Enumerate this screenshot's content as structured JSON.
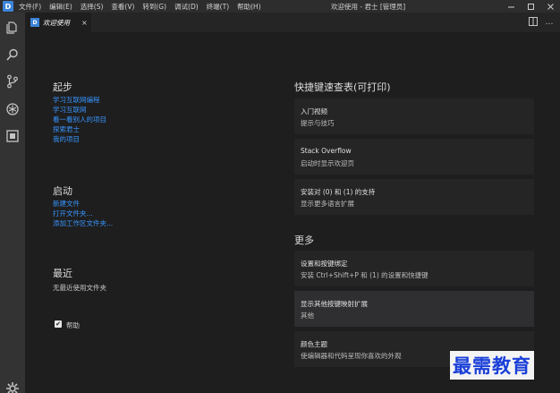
{
  "titlebar": {
    "logo": "D",
    "menu": [
      "文件(F)",
      "编辑(E)",
      "选择(S)",
      "查看(V)",
      "转到(G)",
      "调试(D)",
      "终端(T)",
      "帮助(H)"
    ],
    "title": "欢迎使用 - 君士 [管理员]",
    "window_buttons": [
      "minimize-icon",
      "maximize-icon",
      "close-icon"
    ]
  },
  "activity_bar": [
    "files-icon",
    "search-icon",
    "source-control-icon",
    "debug-icon",
    "extensions-icon",
    "gear-icon"
  ],
  "tab": {
    "label": "欢迎使用",
    "close": "×"
  },
  "welcome": {
    "start": {
      "title": "起步",
      "links": [
        "学习互联网编程",
        "学习互联网",
        "看一看别人的项目",
        "探索君士",
        "我的项目"
      ]
    },
    "launch": {
      "title": "启动",
      "links": [
        "新建文件",
        "打开文件夹...",
        "添加工作区文件夹..."
      ]
    },
    "recent": {
      "title": "最近",
      "empty": "无最近使用文件夹"
    },
    "help_checkbox": {
      "label": "帮助",
      "checked": true
    },
    "shortcuts": {
      "title": "快捷键速查表(可打印)",
      "cards": [
        {
          "title": "入门视频",
          "desc": "提示与技巧"
        },
        {
          "title": "Stack Overflow",
          "desc": "启动时显示欢迎页"
        },
        {
          "title": "安装对 (0) 和 (1) 的支持",
          "desc": "显示更多语言扩展"
        }
      ]
    },
    "more": {
      "title": "更多",
      "cards": [
        {
          "title": "设置和按键绑定",
          "desc": "安装 Ctrl+Shift+P 和 (1) 的设置和快捷键"
        },
        {
          "title": "显示其他按键映射扩展",
          "desc": "其他"
        },
        {
          "title": "颜色主题",
          "desc": "使编辑器和代码呈现你喜欢的外观"
        }
      ]
    }
  },
  "watermark": "最需教育",
  "colors": {
    "accent": "#3b83d8",
    "link": "#3794ff",
    "background": "#1e1e1e"
  }
}
